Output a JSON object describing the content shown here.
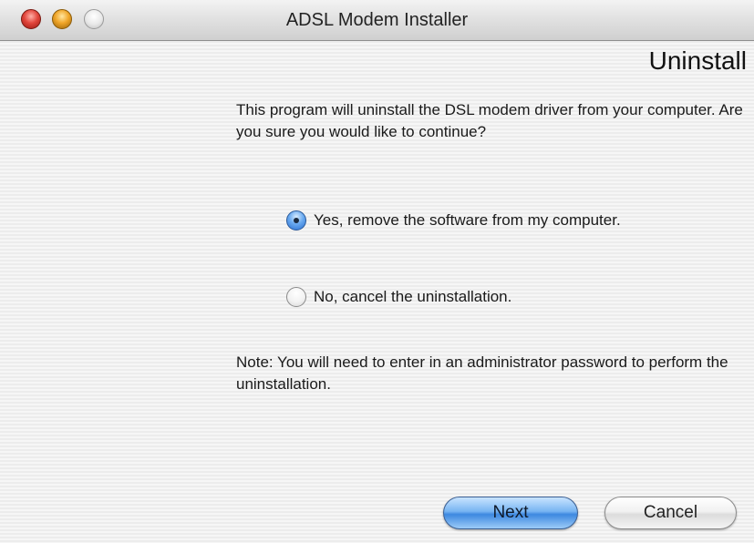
{
  "window": {
    "title": "ADSL Modem Installer",
    "buttons": {
      "close": "close-icon",
      "minimize": "minimize-icon",
      "zoom": "zoom-icon"
    }
  },
  "page": {
    "heading": "Uninstall",
    "description": "This program will uninstall the DSL modem driver from your computer.  Are you sure you would like to continue?",
    "options": [
      {
        "label": "Yes, remove the software from my computer.",
        "selected": true
      },
      {
        "label": "No, cancel the uninstallation.",
        "selected": false
      }
    ],
    "note": "Note: You will need to enter in an administrator password to perform the uninstallation."
  },
  "footer": {
    "next_label": "Next",
    "cancel_label": "Cancel"
  },
  "colors": {
    "accent": "#3d88e0",
    "window_stripes": "#ececec"
  }
}
